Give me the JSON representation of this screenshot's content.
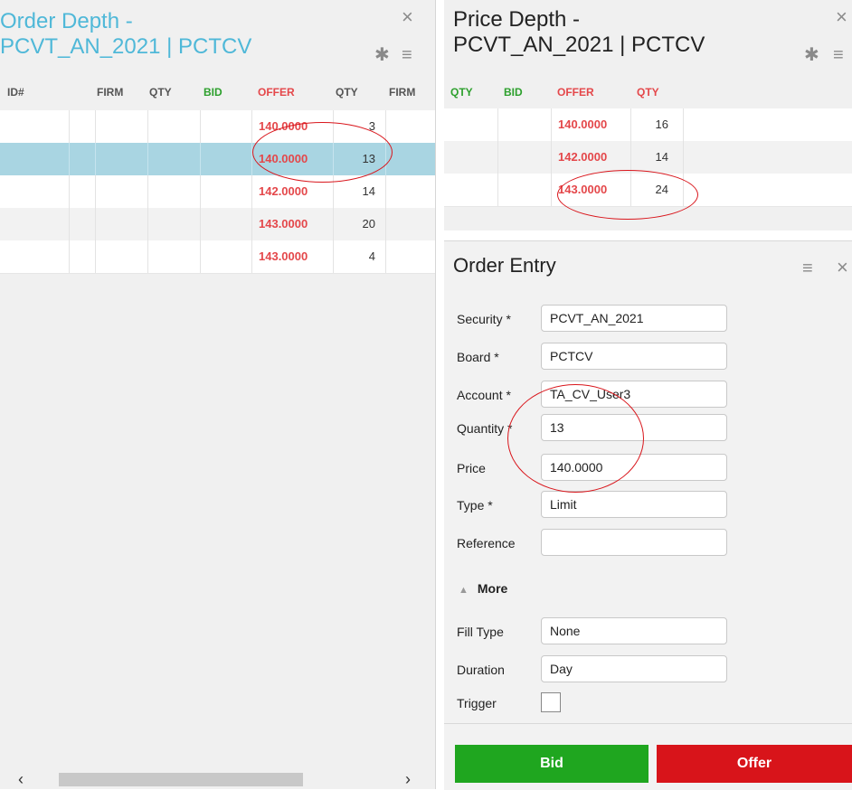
{
  "order_depth": {
    "title_line1": "Order Depth -",
    "title_line2": "PCVT_AN_2021 | PCTCV",
    "columns": [
      "ID#",
      "FIRM",
      "QTY",
      "BID",
      "OFFER",
      "QTY",
      "FIRM"
    ],
    "rows": [
      {
        "offer": "140.0000",
        "qty": "3"
      },
      {
        "offer": "140.0000",
        "qty": "13"
      },
      {
        "offer": "142.0000",
        "qty": "14"
      },
      {
        "offer": "143.0000",
        "qty": "20"
      },
      {
        "offer": "143.0000",
        "qty": "4"
      }
    ],
    "close_glyph": "×"
  },
  "price_depth": {
    "title_line1": "Price Depth -",
    "title_line2": "PCVT_AN_2021 | PCTCV",
    "columns": [
      "QTY",
      "BID",
      "OFFER",
      "QTY"
    ],
    "rows": [
      {
        "offer": "140.0000",
        "qty": "16"
      },
      {
        "offer": "142.0000",
        "qty": "14"
      },
      {
        "offer": "143.0000",
        "qty": "24"
      }
    ],
    "close_glyph": "×"
  },
  "order_entry": {
    "title": "Order Entry",
    "fields": {
      "security_label": "Security *",
      "security_value": "PCVT_AN_2021",
      "board_label": "Board *",
      "board_value": "PCTCV",
      "account_label": "Account *",
      "account_value": "TA_CV_User3",
      "quantity_label": "Quantity *",
      "quantity_value": "13",
      "price_label": "Price",
      "price_value": "140.0000",
      "type_label": "Type *",
      "type_value": "Limit",
      "reference_label": "Reference",
      "reference_value": "",
      "more_label": "More",
      "fill_type_label": "Fill Type",
      "fill_type_value": "None",
      "duration_label": "Duration",
      "duration_value": "Day",
      "trigger_label": "Trigger"
    },
    "bid_label": "Bid",
    "offer_label": "Offer",
    "close_glyph": "×"
  },
  "colors": {
    "title_blue": "#4fb8d8",
    "bid_green": "#1fa61f",
    "offer_red": "#d8141a",
    "price_red": "#e4474a",
    "selected_row": "#a9d5e2",
    "annotation_red": "#d9161c"
  },
  "icons": [
    "close-icon",
    "gear-icon",
    "menu-icon",
    "chevron-left-icon",
    "chevron-right-icon",
    "caret-up-icon"
  ]
}
